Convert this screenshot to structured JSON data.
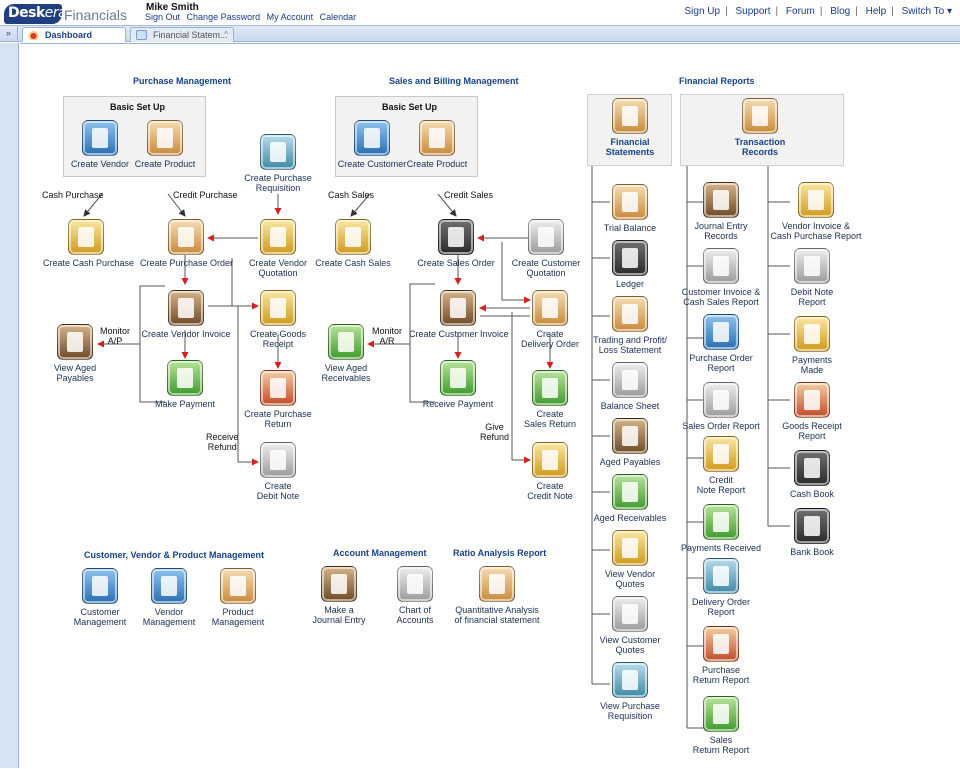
{
  "header": {
    "logo_desk": "Desk",
    "logo_era": "era",
    "logo_product": "Financials",
    "user_name": "Mike Smith",
    "user_links": [
      "Sign Out",
      "Change Password",
      "My Account",
      "Calendar"
    ],
    "nav": [
      "Sign Up",
      "Support",
      "Forum",
      "Blog",
      "Help",
      "Switch To ▾"
    ]
  },
  "tabs": {
    "collapse": "»",
    "dashboard": "Dashboard",
    "financial": "Financial Statem...",
    "close": "^"
  },
  "sections": {
    "purchase": "Purchase Management",
    "sales": "Sales and Billing Management",
    "financial_reports": "Financial Reports",
    "cvp": "Customer, Vendor & Product Management",
    "account": "Account Management",
    "ratio": "Ratio Analysis Report"
  },
  "purchase": {
    "basic_setup": "Basic Set Up",
    "create_vendor": "Create Vendor",
    "create_product": "Create Product",
    "create_purchase_requisition": [
      "Create Purchase",
      "Requisition"
    ],
    "cash_purchase_label": "Cash Purchase",
    "credit_purchase_label": "Credit Purchase",
    "create_cash_purchase": "Create Cash Purchase",
    "create_purchase_order": "Create Purchase Order",
    "create_vendor_quotation": [
      "Create Vendor",
      "Quotation"
    ],
    "create_vendor_invoice": "Create Vendor Invoice",
    "create_goods_receipt": [
      "Create Goods",
      "Receipt"
    ],
    "monitor_ap": [
      "Monitor",
      "A/P"
    ],
    "view_aged_payables": [
      "View Aged",
      "Payables"
    ],
    "make_payment": "Make Payment",
    "create_purchase_return": [
      "Create Purchase",
      "Return"
    ],
    "receive_refund": [
      "Receive",
      "Refund"
    ],
    "create_debit_note": [
      "Create",
      "Debit Note"
    ]
  },
  "sales": {
    "basic_setup": "Basic Set Up",
    "create_customer": "Create Customer",
    "create_product": "Create Product",
    "cash_sales_label": "Cash Sales",
    "credit_sales_label": "Credit Sales",
    "create_cash_sales": "Create Cash Sales",
    "create_sales_order": "Create Sales Order",
    "create_customer_quotation": [
      "Create Customer",
      "Quotation"
    ],
    "create_customer_invoice": "Create Customer Invoice",
    "create_delivery_order": [
      "Create",
      "Delivery Order"
    ],
    "monitor_ar": [
      "Monitor",
      "A/R"
    ],
    "view_aged_receivables": [
      "View Aged",
      "Receivables"
    ],
    "receive_payment": "Receive Payment",
    "create_sales_return": [
      "Create",
      "Sales Return"
    ],
    "give_refund": [
      "Give",
      "Refund"
    ],
    "create_credit_note": [
      "Create",
      "Credit Note"
    ]
  },
  "financial_statements": {
    "title": [
      "Financial",
      "Statements"
    ],
    "items": [
      [
        "Trial Balance"
      ],
      [
        "Ledger"
      ],
      [
        "Trading and Profit/",
        "Loss Statement"
      ],
      [
        "Balance Sheet"
      ],
      [
        "Aged Payables"
      ],
      [
        "Aged Receivables"
      ],
      [
        "View Vendor",
        "Quotes"
      ],
      [
        "View Customer",
        "Quotes"
      ],
      [
        "View Purchase",
        "Requisition"
      ]
    ]
  },
  "transaction_records": {
    "title": [
      "Transaction",
      "Records"
    ],
    "col1": [
      [
        "Journal Entry",
        "Records"
      ],
      [
        "Customer Invoice &",
        "Cash Sales Report"
      ],
      [
        "Purchase Order",
        "Report"
      ],
      [
        "Sales Order Report"
      ],
      [
        "Credit",
        "Note Report"
      ],
      [
        "Payments Received"
      ],
      [
        "Delivery Order",
        "Report"
      ],
      [
        "Purchase",
        "Return Report"
      ],
      [
        "Sales",
        "Return Report"
      ]
    ],
    "col2": [
      [
        "Vendor Invoice &",
        "Cash Purchase Report"
      ],
      [
        "Debit Note",
        "Report"
      ],
      [
        "Payments",
        "Made"
      ],
      [
        "Goods Receipt",
        "Report"
      ],
      [
        "Cash Book"
      ],
      [
        "Bank Book"
      ]
    ]
  },
  "cvp": {
    "customer": [
      "Customer",
      "Management"
    ],
    "vendor": [
      "Vendor",
      "Management"
    ],
    "product": [
      "Product",
      "Management"
    ]
  },
  "account": {
    "journal": [
      "Make a",
      "Journal Entry"
    ],
    "chart": [
      "Chart of",
      "Accounts"
    ]
  },
  "ratio": {
    "quant": [
      "Quantitative Analysis",
      "of financial statement"
    ]
  }
}
